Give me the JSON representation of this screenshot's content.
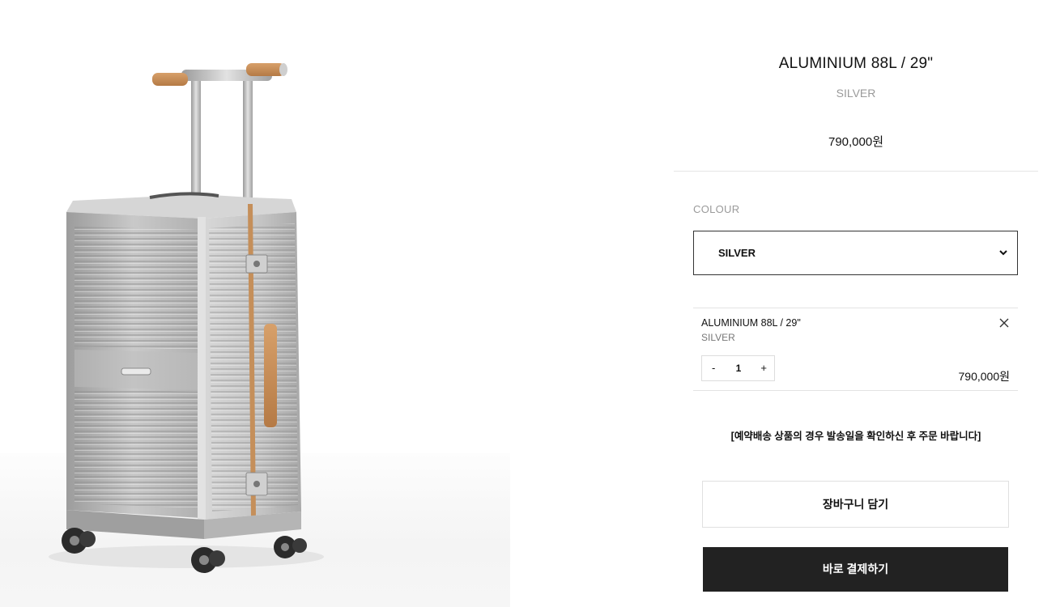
{
  "product": {
    "image_icon": "aluminium-suitcase-image",
    "title": "ALUMINIUM 88L / 29\"",
    "color_name": "SILVER",
    "price": "790,000원"
  },
  "colour_option": {
    "label": "COLOUR",
    "selected": "SILVER",
    "icon": "chevron-down-icon"
  },
  "selected_item": {
    "name": "ALUMINIUM 88L / 29\"",
    "colour": "SILVER",
    "decrement_label": "-",
    "quantity": "1",
    "increment_label": "+",
    "price": "790,000원",
    "remove_icon": "close-icon"
  },
  "notice": "[예약배송 상품의 경우 발송일을 확인하신 후 주문 바랍니다]",
  "buttons": {
    "add_to_cart": "장바구니 담기",
    "buy_now": "바로 결제하기"
  },
  "colors": {
    "buy_button_bg": "#222222",
    "muted_text": "#9a9a9a"
  }
}
